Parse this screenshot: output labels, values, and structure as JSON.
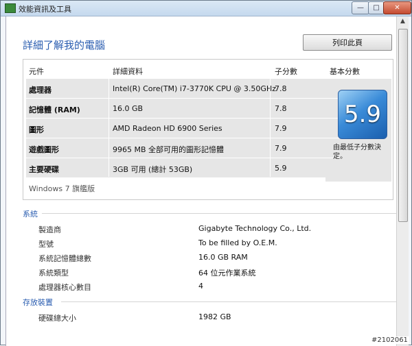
{
  "window": {
    "title": "效能資訊及工具",
    "min": "—",
    "max": "□",
    "close": "✕"
  },
  "heading": "詳細了解我的電腦",
  "print_button": "列印此頁",
  "table": {
    "headers": [
      "元件",
      "詳細資料",
      "子分數",
      "基本分數"
    ],
    "rows": [
      {
        "component": "處理器",
        "detail": "Intel(R) Core(TM) i7-3770K CPU @ 3.50GHz",
        "subscore": "7.8"
      },
      {
        "component": "記憶體 (RAM)",
        "detail": "16.0 GB",
        "subscore": "7.8"
      },
      {
        "component": "圖形",
        "detail": "AMD Radeon HD 6900 Series",
        "subscore": "7.9"
      },
      {
        "component": "遊戲圖形",
        "detail": "9965 MB 全部可用的圖形記憶體",
        "subscore": "7.9"
      },
      {
        "component": "主要硬碟",
        "detail": "3GB 可用 (總計 53GB)",
        "subscore": "5.9"
      }
    ],
    "base_score": "5.9",
    "base_caption": "由最低子分數決定。",
    "edition": "Windows 7 旗艦版"
  },
  "system": {
    "title": "系統",
    "items": [
      {
        "label": "製造商",
        "value": "Gigabyte Technology Co., Ltd."
      },
      {
        "label": "型號",
        "value": "To be filled by O.E.M."
      },
      {
        "label": "系統記憶體總數",
        "value": "16.0 GB RAM"
      },
      {
        "label": "系統類型",
        "value": "64 位元作業系統"
      },
      {
        "label": "處理器核心數目",
        "value": "4"
      }
    ]
  },
  "storage": {
    "title": "存放裝置",
    "items": [
      {
        "label": "硬碟總大小",
        "value": "1982 GB"
      }
    ]
  },
  "watermark": "#2102061",
  "scroll_up": "▲"
}
